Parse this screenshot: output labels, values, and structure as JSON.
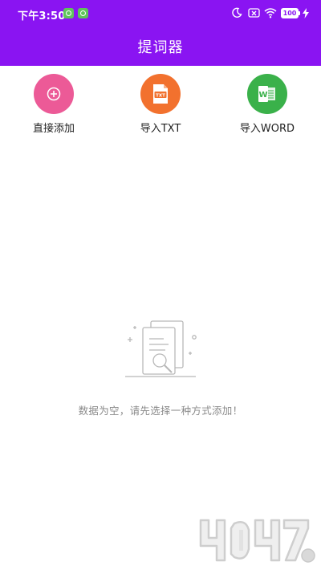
{
  "status_bar": {
    "time": "下午3:50",
    "battery": "100",
    "icons": [
      "message-icon",
      "message-icon",
      "moon-icon",
      "no-sim-icon",
      "wifi-icon",
      "battery-icon",
      "charging-bolt-icon"
    ]
  },
  "app_bar": {
    "title": "提词器"
  },
  "actions": [
    {
      "label": "直接添加",
      "icon": "plus-icon",
      "color": "#ec5a97"
    },
    {
      "label": "导入TXT",
      "icon": "txt-file-icon",
      "color": "#f2712e"
    },
    {
      "label": "导入WORD",
      "icon": "word-icon",
      "color": "#3ab14a"
    }
  ],
  "empty_state": {
    "message": "数据为空，请先选择一种方式添加！",
    "icon": "empty-document-search-icon"
  },
  "colors": {
    "header": "#8a14f2",
    "empty_text": "#8a8a8a"
  }
}
